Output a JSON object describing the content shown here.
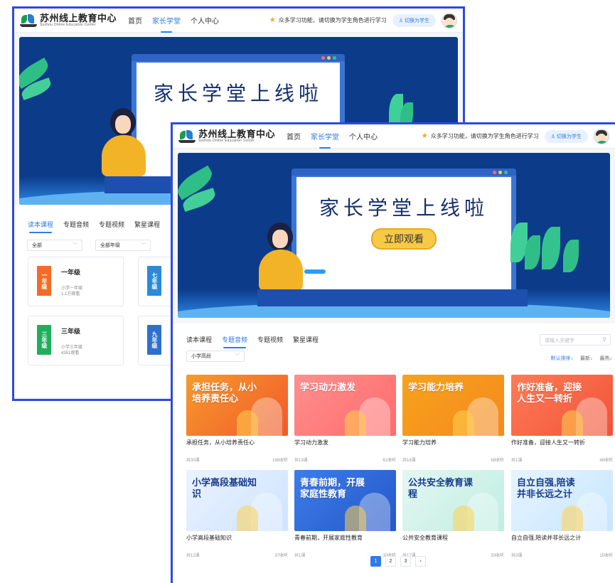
{
  "app": {
    "logo_cn": "苏州线上教育中心",
    "logo_en": "Suzhou Online Education Center",
    "nav": [
      "首页",
      "家长学堂",
      "个人中心"
    ],
    "active_nav": "家长学堂",
    "notice": "众多学习功能，请切换为学生角色进行学习",
    "switch_label": "切换为学生"
  },
  "banner": {
    "title": "家长学堂上线啦",
    "watch_label": "立即观看"
  },
  "back_window": {
    "tabs": [
      "读本课程",
      "专题音频",
      "专题视频",
      "繁星课程"
    ],
    "active_tab": "读本课程",
    "filters": [
      "全部",
      "全部年级"
    ],
    "grades": [
      {
        "cover": "一年级",
        "name": "一年级",
        "sub1": "小学一年级",
        "sub2": "1.1万观看",
        "color": "#f36b26"
      },
      {
        "cover": "七年级",
        "name": "",
        "sub1": "",
        "sub2": "",
        "color": "#2a8ad8"
      },
      {
        "cover": "三年级",
        "name": "三年级",
        "sub1": "小学三年级",
        "sub2": "4351观看",
        "color": "#1fae5c"
      },
      {
        "cover": "九年级",
        "name": "",
        "sub1": "",
        "sub2": "",
        "color": "#2f6fd0"
      }
    ]
  },
  "front_window": {
    "tabs": [
      "读本课程",
      "专题音频",
      "专题视频",
      "繁星课程"
    ],
    "active_tab": "专题音频",
    "search_placeholder": "请输入关键字",
    "filter": "小学高段",
    "sorts": [
      "默认排序↓",
      "最新↓",
      "最热↓"
    ],
    "courses": [
      {
        "thumb": "承担任务，从小培养责任心",
        "title": "承担任务，从小培养责任心",
        "lessons": "共30课",
        "listens": "186收听",
        "bg": "linear-gradient(135deg,#f79a2c,#f15a2b)",
        "dark": false
      },
      {
        "thumb": "学习动力激发",
        "title": "学习动力激发",
        "lessons": "共13课",
        "listens": "61收听",
        "bg": "linear-gradient(135deg,#ff8f8f,#ff6b6b)",
        "dark": false
      },
      {
        "thumb": "学习能力培养",
        "title": "学习能力培养",
        "lessons": "共18课",
        "listens": "58收听",
        "bg": "linear-gradient(135deg,#f7a21b,#f58a1f)",
        "dark": false
      },
      {
        "thumb": "作好准备，迎接人生又一转折",
        "title": "作好准备，迎接人生又一转折",
        "lessons": "共1课",
        "listens": "48收听",
        "bg": "linear-gradient(135deg,#ff7b55,#f0543a)",
        "dark": false
      },
      {
        "thumb": "小学高段基础知识",
        "title": "小学高段基础知识",
        "lessons": "共12课",
        "listens": "37收听",
        "bg": "linear-gradient(135deg,#eaf3ff,#cfe3ff)",
        "dark": true
      },
      {
        "thumb": "青春前期，开展家庭性教育",
        "title": "青春前期，开展家庭性教育",
        "lessons": "共1课",
        "listens": "30收听",
        "bg": "linear-gradient(135deg,#3d7de8,#2558c9)",
        "dark": false
      },
      {
        "thumb": "公共安全教育课程",
        "title": "公共安全教育课程",
        "lessons": "共17课",
        "listens": "20收听",
        "bg": "linear-gradient(135deg,#e4f7f2,#bfeee0)",
        "dark": true
      },
      {
        "thumb": "自立自强,陪读并非长远之计",
        "title": "自立自强,陪读并非长远之计",
        "lessons": "共3课",
        "listens": "15收听",
        "bg": "linear-gradient(135deg,#e6f4ff,#c8e6ff)",
        "dark": true
      }
    ],
    "pages": [
      "1",
      "2",
      "3",
      "›"
    ],
    "active_page": "1"
  }
}
